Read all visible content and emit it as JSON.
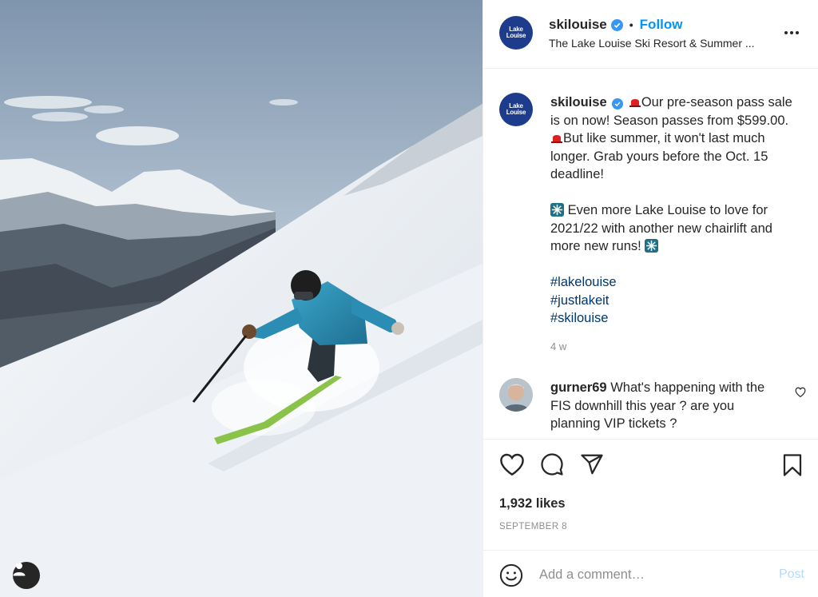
{
  "header": {
    "username": "skilouise",
    "separator": "•",
    "follow_label": "Follow",
    "subtitle": "The Lake Louise Ski Resort & Summer ...",
    "logo_line1": "Lake",
    "logo_line2": "Louise"
  },
  "caption": {
    "username": "skilouise",
    "line1": "Our pre-season pass sale is on now! Season passes from $599.00.",
    "line2": "But like summer, it won't last much longer. Grab yours before the Oct. 15 deadline!",
    "line3": "Even more Lake Louise to love for 2021/22 with another new chairlift and more new runs!",
    "hashtags": [
      "#lakelouise",
      "#justlakeit",
      "#skilouise"
    ],
    "age": "4 w"
  },
  "comment": {
    "username": "gurner69",
    "text": "What's happening with the FIS downhill this year ? are you planning VIP tickets ?"
  },
  "actions": {
    "likes": "1,932 likes",
    "date": "SEPTEMBER 8"
  },
  "add_comment": {
    "placeholder": "Add a comment…",
    "post_label": "Post"
  },
  "icons": {
    "verified": "verified-badge-icon",
    "more": "more-options-icon",
    "like": "heart-icon",
    "comment": "comment-bubble-icon",
    "share": "paper-plane-icon",
    "save": "bookmark-icon",
    "emoji": "smiley-icon",
    "user_tags": "user-tag-icon"
  },
  "colors": {
    "link_blue": "#0095f6",
    "hashtag": "#00376b",
    "muted": "#8e8e8e",
    "post_disabled": "#b3dbff",
    "logo_navy": "#1d3d8c"
  }
}
